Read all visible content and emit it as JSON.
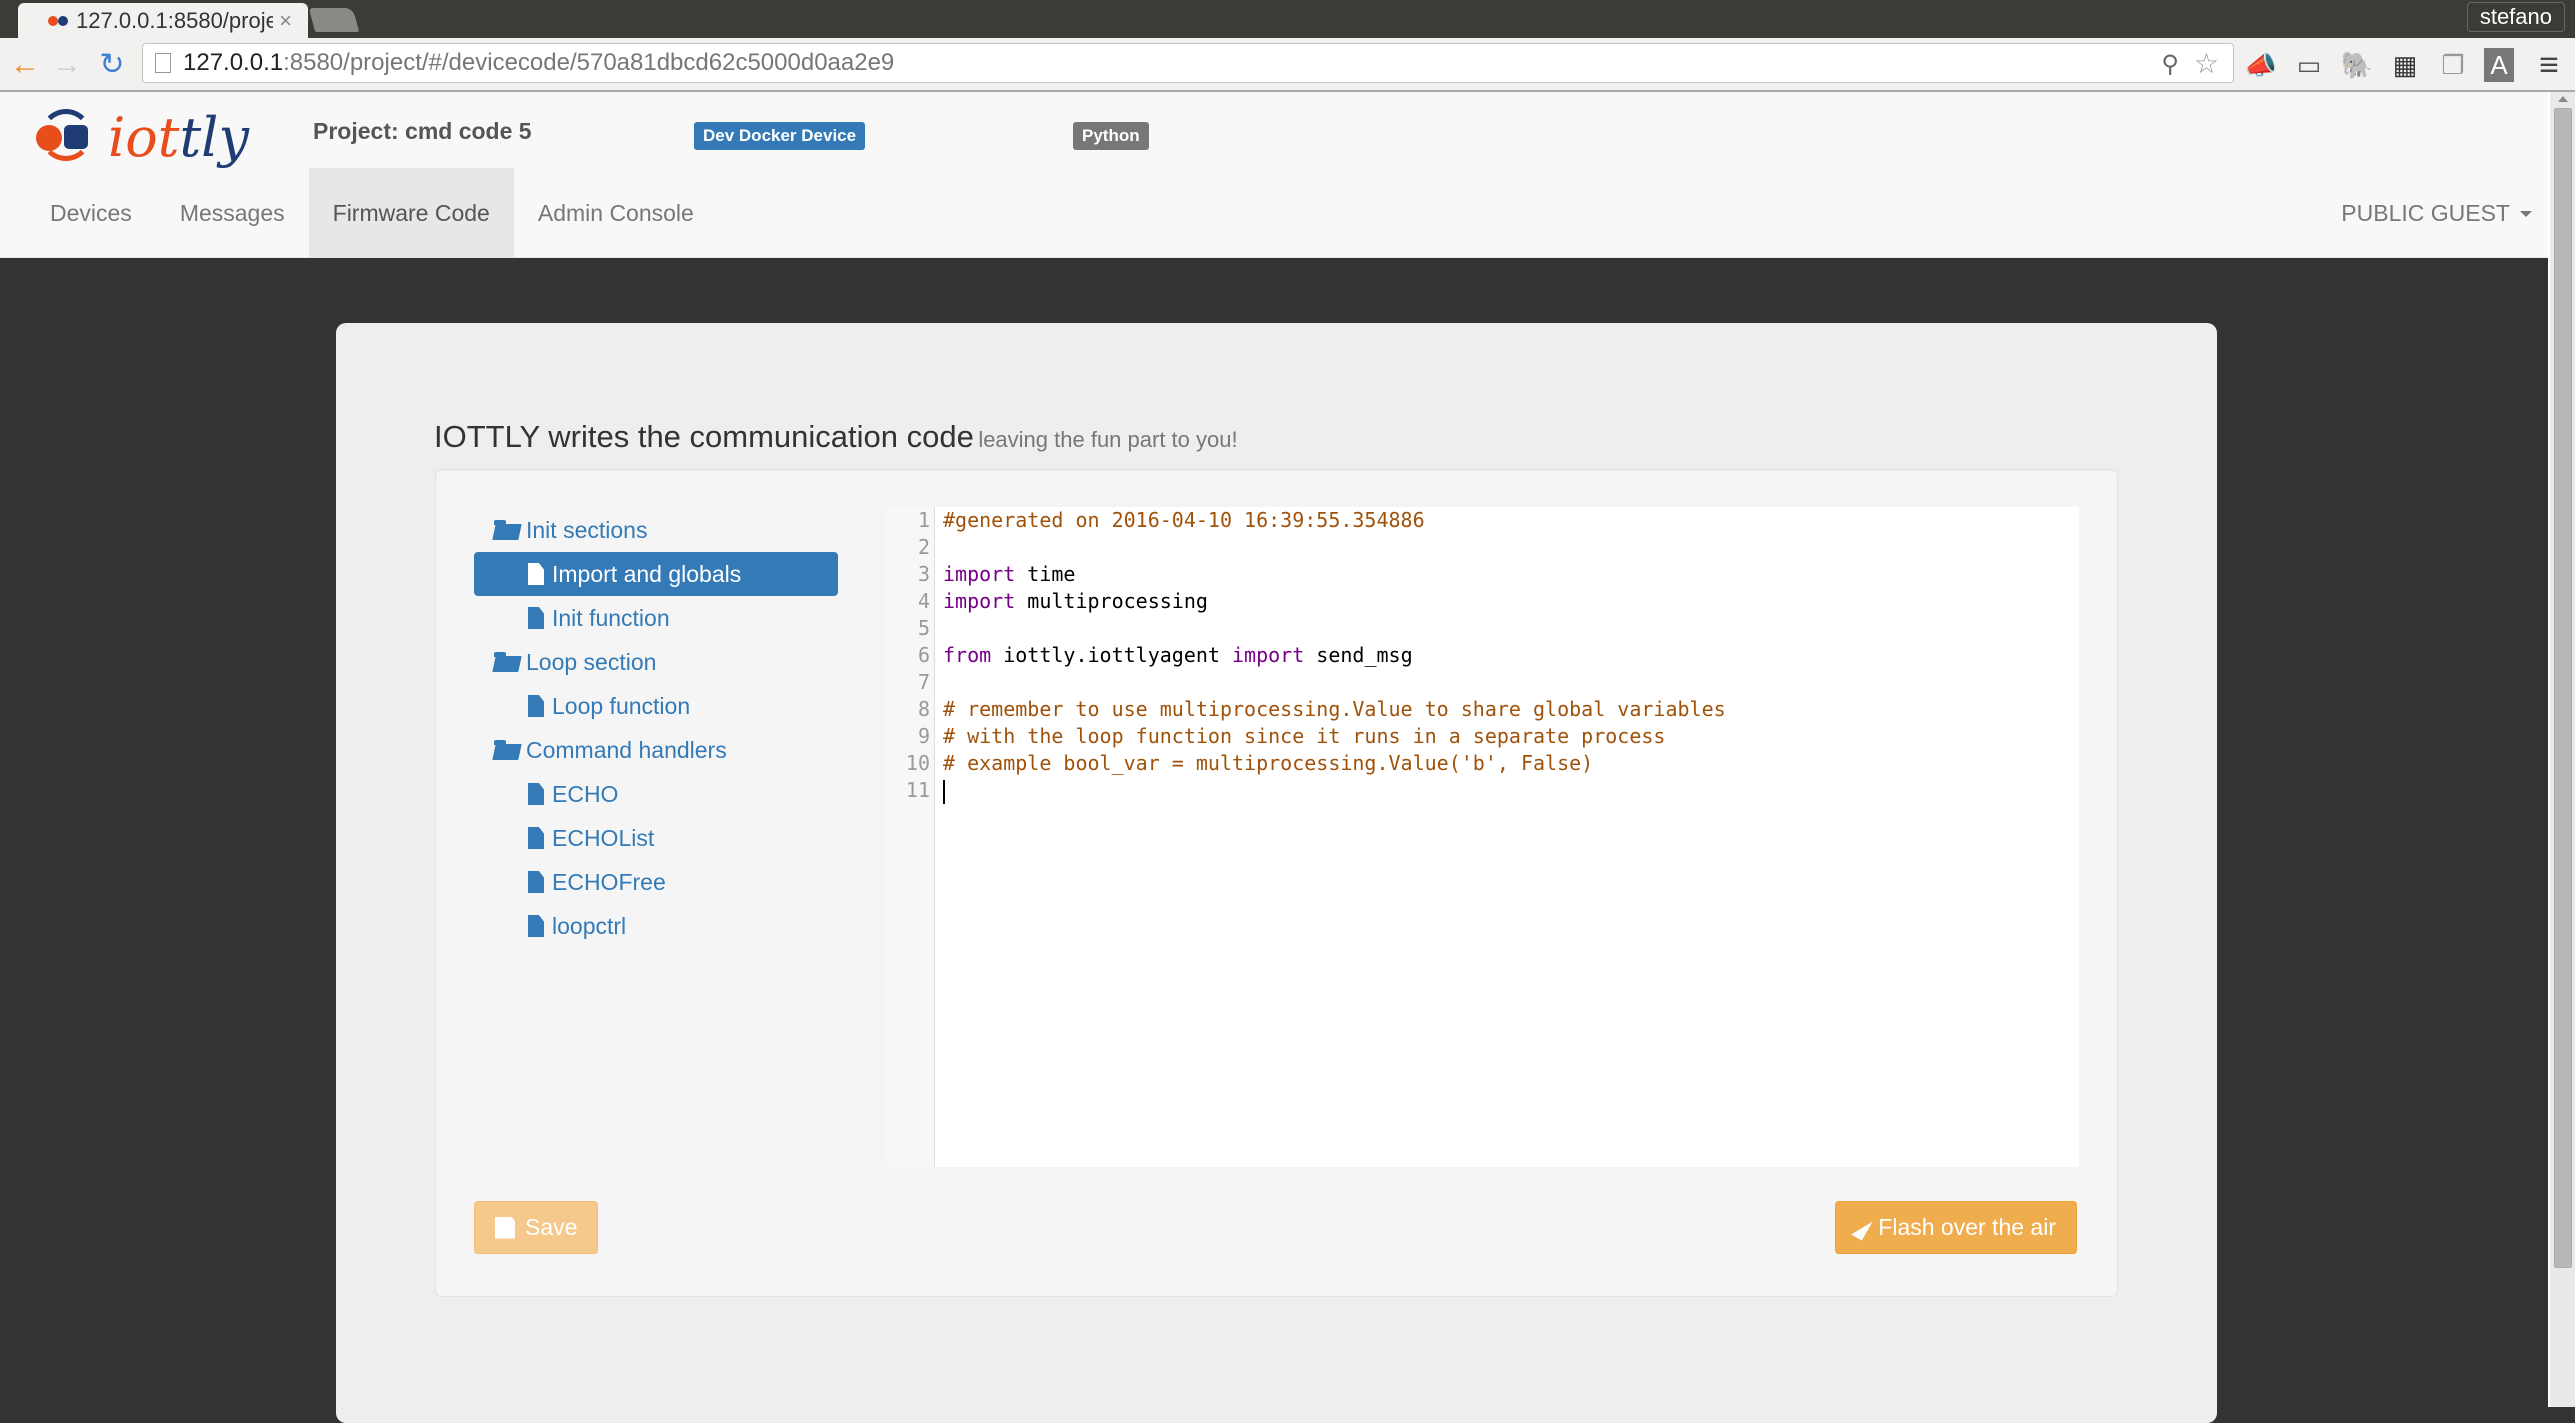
{
  "browser": {
    "tab_title": "127.0.0.1:8580/proje",
    "tab_close": "×",
    "user": "stefano",
    "url_host": "127.0.0.1",
    "url_path": ":8580/project/#/devicecode/570a81dbcd62c5000d0aa2e9",
    "icons": {
      "back": "←",
      "forward": "→",
      "reload": "↻",
      "zoom": "⚲",
      "star": "☆",
      "announce": "📣",
      "cast": "▭",
      "evernote": "🐘",
      "film": "▦",
      "copy": "❐",
      "font": "A",
      "menu": "≡"
    }
  },
  "header": {
    "logo_a": "iot",
    "logo_b": "tly",
    "project": "Project: cmd code 5",
    "device_label": "Dev Docker Device",
    "language_label": "Python",
    "nav": [
      {
        "label": "Devices",
        "active": false
      },
      {
        "label": "Messages",
        "active": false
      },
      {
        "label": "Firmware Code",
        "active": true
      },
      {
        "label": "Admin Console",
        "active": false
      }
    ],
    "user_menu": "PUBLIC GUEST"
  },
  "main": {
    "headline": "IOTTLY writes the communication code",
    "subheadline": "leaving the fun part to you!",
    "tree": [
      {
        "type": "folder",
        "label": "Init sections",
        "active": false
      },
      {
        "type": "file",
        "label": "Import and globals",
        "active": true
      },
      {
        "type": "file",
        "label": "Init function",
        "active": false
      },
      {
        "type": "folder",
        "label": "Loop section",
        "active": false
      },
      {
        "type": "file",
        "label": "Loop function",
        "active": false
      },
      {
        "type": "folder",
        "label": "Command handlers",
        "active": false
      },
      {
        "type": "file",
        "label": "ECHO",
        "active": false
      },
      {
        "type": "file",
        "label": "ECHOList",
        "active": false
      },
      {
        "type": "file",
        "label": "ECHOFree",
        "active": false
      },
      {
        "type": "file",
        "label": "loopctrl",
        "active": false
      }
    ],
    "code_lines": [
      [
        {
          "t": "cm",
          "s": "#generated on 2016-04-10 16:39:55.354886"
        }
      ],
      [],
      [
        {
          "t": "kw",
          "s": "import"
        },
        {
          "t": "",
          "s": " time"
        }
      ],
      [
        {
          "t": "kw",
          "s": "import"
        },
        {
          "t": "",
          "s": " multiprocessing"
        }
      ],
      [],
      [
        {
          "t": "kw",
          "s": "from"
        },
        {
          "t": "",
          "s": " iottly.iottlyagent "
        },
        {
          "t": "kw",
          "s": "import"
        },
        {
          "t": "",
          "s": " send_msg"
        }
      ],
      [],
      [
        {
          "t": "cm",
          "s": "# remember to use multiprocessing.Value to share global variables"
        }
      ],
      [
        {
          "t": "cm",
          "s": "# with the loop function since it runs in a separate process"
        }
      ],
      [
        {
          "t": "cm",
          "s": "# example bool_var = multiprocessing.Value('b', False)"
        }
      ],
      []
    ],
    "cursor_line": 11,
    "save_label": "Save",
    "flash_label": "Flash over the air"
  },
  "colors": {
    "primary": "#337ab7",
    "warning": "#f0ad4e",
    "comment": "#a0520a",
    "keyword": "#770088"
  }
}
